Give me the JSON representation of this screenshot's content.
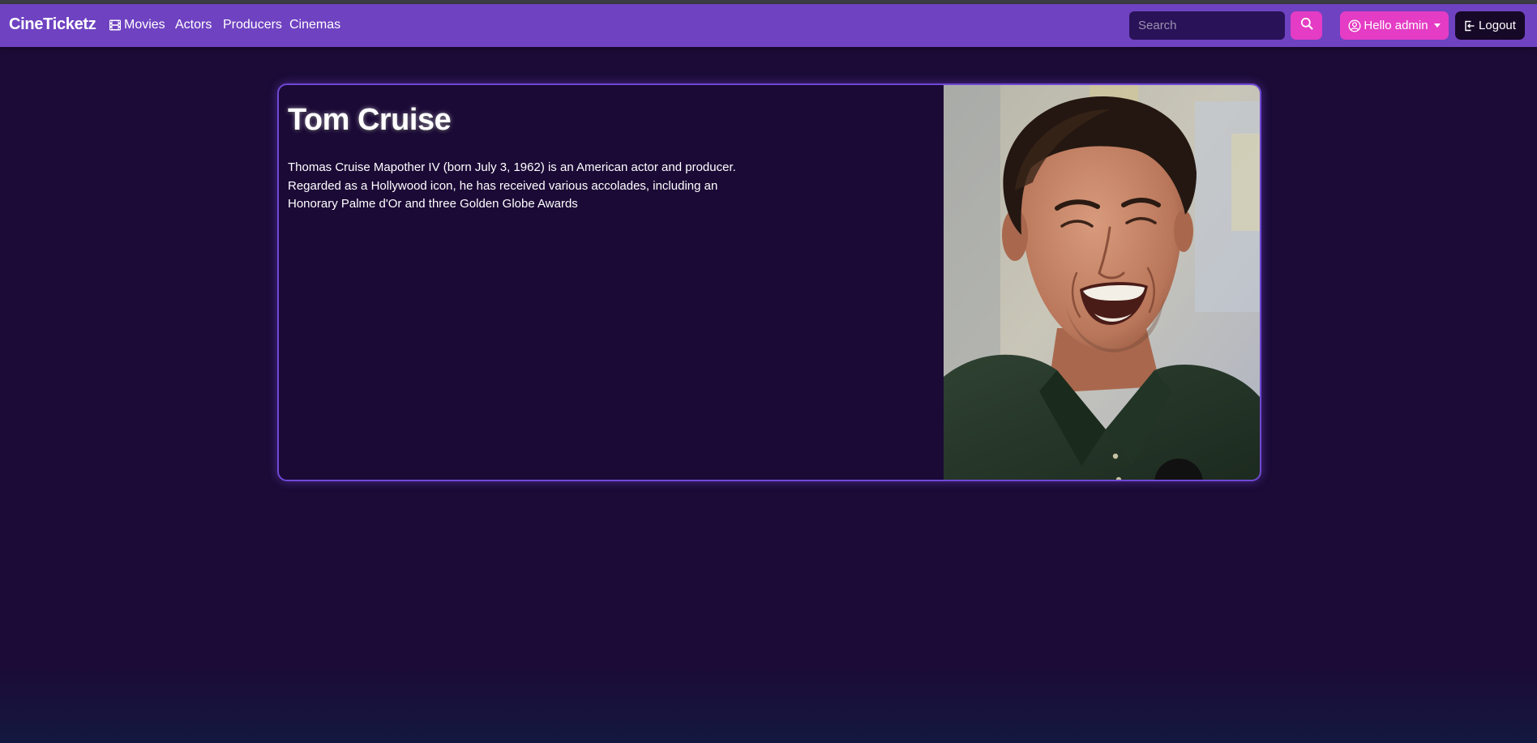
{
  "navbar": {
    "brand": "CineTicketz",
    "links": [
      {
        "label": "Movies",
        "icon": "film-icon"
      },
      {
        "label": "Actors"
      },
      {
        "label": "Producers"
      },
      {
        "label": "Cinemas"
      }
    ],
    "search_placeholder": "Search",
    "search_icon": "search-icon",
    "user_label": "Hello admin",
    "user_icon": "user-circle-icon",
    "logout_label": "Logout",
    "logout_icon": "logout-icon"
  },
  "actor": {
    "name": "Tom Cruise",
    "bio": "Thomas Cruise Mapother IV (born July 3, 1962) is an American actor and producer. Regarded as a Hollywood icon, he has received various accolades, including an Honorary Palme d'Or and three Golden Globe Awards",
    "photo": "actor-portrait"
  },
  "colors": {
    "navbar": "#6f42c1",
    "accent_pink": "#e43cc4",
    "page_background": "#1b0b36",
    "card_border": "#7048d4",
    "logout_button": "#160827"
  }
}
